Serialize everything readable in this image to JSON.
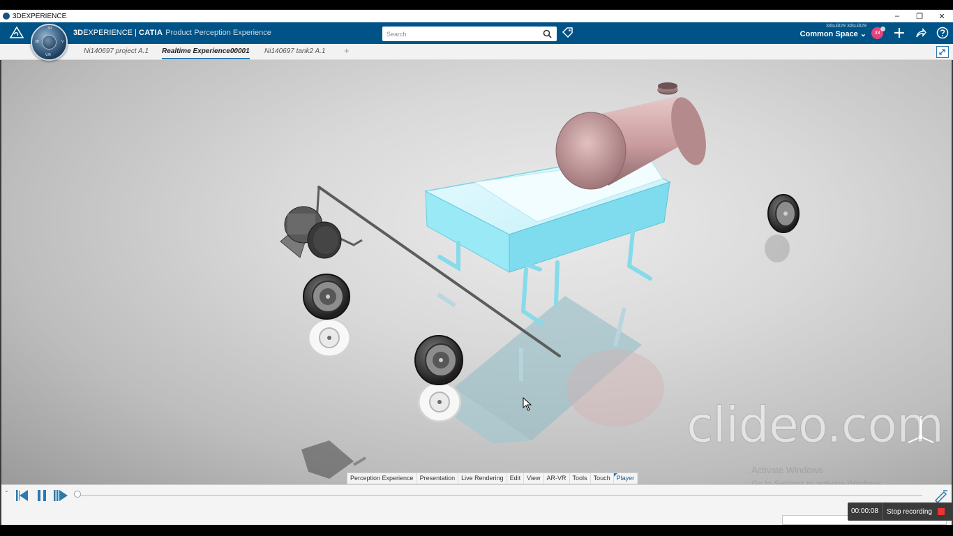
{
  "window": {
    "title": "3DEXPERIENCE",
    "controls": {
      "minimize": "–",
      "restore": "❐",
      "close": "✕"
    }
  },
  "header": {
    "brand_3d": "3D",
    "brand_experience": "EXPERIENCE",
    "brand_separator": " | ",
    "brand_app": "CATIA",
    "brand_subtitle": "Product Perception Experience",
    "compass_labels": {
      "top": "3D",
      "left": "3D",
      "right": "V",
      "bottom": "V.R"
    },
    "search": {
      "placeholder": "Search",
      "value": ""
    },
    "user_names": "3dsuiit29 3dsuiit29",
    "space": "Common Space ⌄",
    "notification_count": "33",
    "icons": [
      "ds-logo-icon",
      "search-icon",
      "tag-icon",
      "add-icon",
      "share-icon",
      "help-icon"
    ]
  },
  "tabs": [
    {
      "label": "Ni140697 project A.1",
      "active": false
    },
    {
      "label": "Realtime Experience00001",
      "active": true
    },
    {
      "label": "Ni140697 tank2 A.1",
      "active": false
    }
  ],
  "tab_add": "+",
  "action_bar": {
    "tabs": [
      "Perception Experience",
      "Presentation",
      "Live Rendering",
      "Edit",
      "View",
      "AR-VR",
      "Tools",
      "Touch",
      "Player"
    ],
    "active": "Player"
  },
  "player": {
    "menu": "⌄",
    "progress": 0
  },
  "recorder": {
    "time": "00:00:08",
    "label": "Stop recording"
  },
  "overlay": {
    "watermark": "clideo.com",
    "activate_line1": "Activate Windows",
    "activate_line2": "Go to Settings to activate Windows."
  },
  "colors": {
    "header_bg": "#005386",
    "accent": "#2a7ab0",
    "model_cyan": "#a8eef8",
    "tank_pink": "#caa0a3",
    "notif": "#e8417c",
    "stop": "#e33333"
  }
}
